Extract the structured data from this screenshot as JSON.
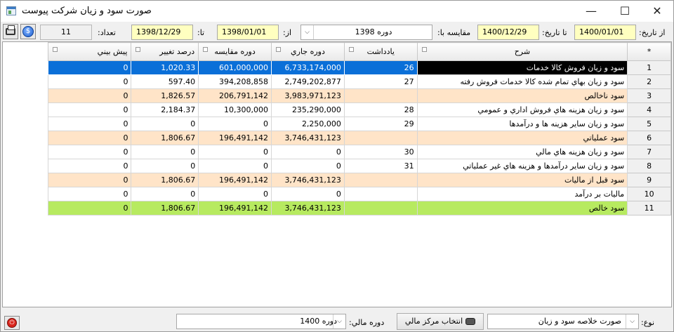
{
  "window": {
    "title": "صورت سود و زيان شركت پيوست",
    "minimize": "—",
    "maximize": "☐",
    "close": "✕"
  },
  "filters": {
    "from_date_label": "از تاريخ:",
    "from_date": "1400/01/01",
    "to_date_label": "تا تاريخ:",
    "to_date": "1400/12/29",
    "compare_label": "مقايسه با:",
    "compare_value": "دوره 1398",
    "compare_from_label": "از:",
    "compare_from": "1398/01/01",
    "compare_to_label": "تا:",
    "compare_to": "1398/12/29",
    "count_label": "تعداد:",
    "count_value": "11"
  },
  "icons": {
    "print": "printer-icon",
    "globe_glyph": "$",
    "power_glyph": "⏻",
    "select_glyph": "▶"
  },
  "grid": {
    "row_header": "*",
    "columns": {
      "desc": "شرح",
      "note": "يادداشت",
      "current": "دوره جاري",
      "compare": "دوره مقايسه",
      "change": "درصد تغيير",
      "forecast": "پيش بيني"
    },
    "rows": [
      {
        "n": "1",
        "desc": "سود و زيان فروش كالا خدمات",
        "note": "26",
        "current": "6,733,174,000",
        "compare": "601,000,000",
        "change": "1,020.33",
        "forecast": "0"
      },
      {
        "n": "2",
        "desc": "سود و زيان بهاي تمام شده كالا خدمات فروش رفته",
        "note": "27",
        "current": "2,749,202,877",
        "compare": "394,208,858",
        "change": "597.40",
        "forecast": "0"
      },
      {
        "n": "3",
        "desc": "سود ناخالص",
        "note": "",
        "current": "3,983,971,123",
        "compare": "206,791,142",
        "change": "1,826.57",
        "forecast": "0"
      },
      {
        "n": "4",
        "desc": "سود و زيان هزينه هاي فروش اداري و عمومي",
        "note": "28",
        "current": "235,290,000",
        "compare": "10,300,000",
        "change": "2,184.37",
        "forecast": "0"
      },
      {
        "n": "5",
        "desc": "سود و زيان ساير هزينه ها و درآمدها",
        "note": "29",
        "current": "2,250,000",
        "compare": "0",
        "change": "0",
        "forecast": "0"
      },
      {
        "n": "6",
        "desc": "سود عملياتي",
        "note": "",
        "current": "3,746,431,123",
        "compare": "196,491,142",
        "change": "1,806.67",
        "forecast": "0"
      },
      {
        "n": "7",
        "desc": "سود و زيان هزينه هاي مالي",
        "note": "30",
        "current": "0",
        "compare": "0",
        "change": "0",
        "forecast": "0"
      },
      {
        "n": "8",
        "desc": "سود و زيان ساير درآمدها و هزينه هاي غير عملياتي",
        "note": "31",
        "current": "0",
        "compare": "0",
        "change": "0",
        "forecast": "0"
      },
      {
        "n": "9",
        "desc": "سود قبل از ماليات",
        "note": "",
        "current": "3,746,431,123",
        "compare": "196,491,142",
        "change": "1,806.67",
        "forecast": "0"
      },
      {
        "n": "10",
        "desc": "ماليات بر درآمد",
        "note": "",
        "current": "0",
        "compare": "0",
        "change": "0",
        "forecast": "0"
      },
      {
        "n": "11",
        "desc": "سود خالص",
        "note": "",
        "current": "3,746,431,123",
        "compare": "196,491,142",
        "change": "1,806.67",
        "forecast": "0"
      }
    ]
  },
  "footer": {
    "type_label": "نوع:",
    "type_value": "صورت خلاصه سود و زيان",
    "cost_center_button": "انتخاب مركز مالي",
    "period_label": "دوره مالي:",
    "period_value": "دوره 1400"
  },
  "colors": {
    "selected_row": "#0a6fd8",
    "subtotal_row": "#ffe4c8",
    "total_row": "#b7ea60",
    "date_field": "#ffffc0"
  }
}
